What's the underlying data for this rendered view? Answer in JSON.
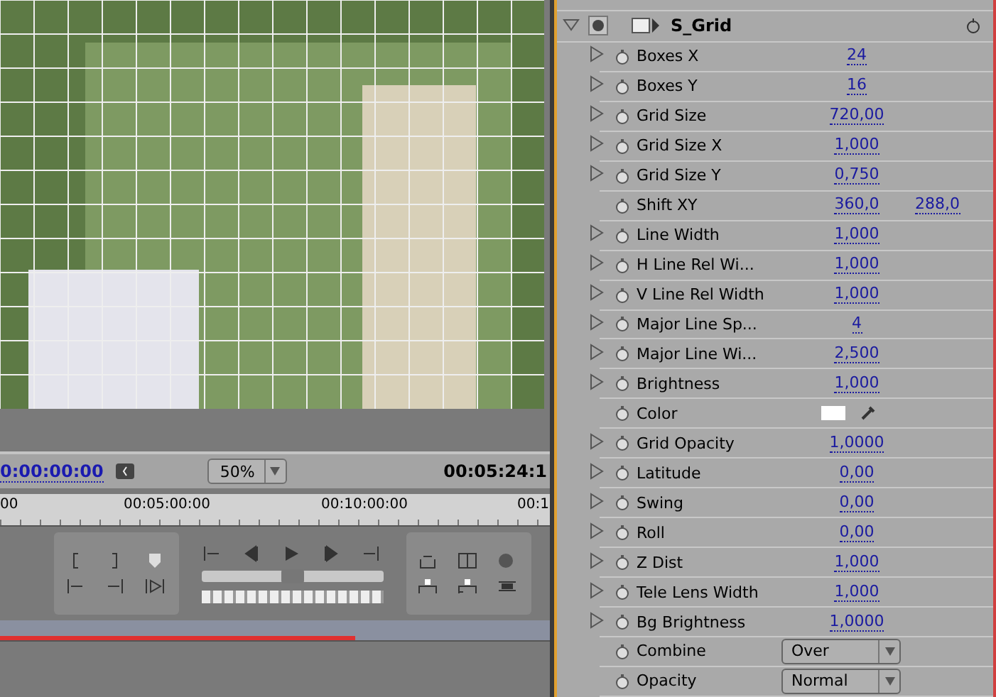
{
  "monitor": {
    "current_time": "0:00:00:00",
    "zoom": "50%",
    "duration": "00:05:24:1"
  },
  "ruler": {
    "labels": [
      "00",
      "00:05:00:00",
      "00:10:00:00",
      "00:1"
    ]
  },
  "timeline": {
    "level": 0.645
  },
  "shuttle": {
    "level": 0.5
  },
  "effect": {
    "name": "S_Grid",
    "expanded": true
  },
  "params": [
    {
      "kind": "value",
      "label": "Boxes X",
      "value": "24",
      "expandable": true
    },
    {
      "kind": "value",
      "label": "Boxes Y",
      "value": "16",
      "expandable": true
    },
    {
      "kind": "value",
      "label": "Grid Size",
      "value": "720,00",
      "expandable": true
    },
    {
      "kind": "value",
      "label": "Grid Size X",
      "value": "1,000",
      "expandable": true
    },
    {
      "kind": "value",
      "label": "Grid Size Y",
      "value": "0,750",
      "expandable": true
    },
    {
      "kind": "pair",
      "label": "Shift XY",
      "value": "360,0",
      "value2": "288,0",
      "expandable": false
    },
    {
      "kind": "value",
      "label": "Line Width",
      "value": "1,000",
      "expandable": true
    },
    {
      "kind": "value",
      "label": "H Line Rel Wi...",
      "value": "1,000",
      "expandable": true
    },
    {
      "kind": "value",
      "label": "V Line Rel Width",
      "value": "1,000",
      "expandable": true
    },
    {
      "kind": "value",
      "label": "Major Line Sp...",
      "value": "4",
      "expandable": true
    },
    {
      "kind": "value",
      "label": "Major Line Wi...",
      "value": "2,500",
      "expandable": true
    },
    {
      "kind": "value",
      "label": "Brightness",
      "value": "1,000",
      "expandable": true
    },
    {
      "kind": "color",
      "label": "Color",
      "color": "#ffffff",
      "expandable": false
    },
    {
      "kind": "value",
      "label": "Grid Opacity",
      "value": "1,0000",
      "expandable": true
    },
    {
      "kind": "value",
      "label": "Latitude",
      "value": "0,00",
      "expandable": true
    },
    {
      "kind": "value",
      "label": "Swing",
      "value": "0,00",
      "expandable": true
    },
    {
      "kind": "value",
      "label": "Roll",
      "value": "0,00",
      "expandable": true
    },
    {
      "kind": "value",
      "label": "Z Dist",
      "value": "1,000",
      "expandable": true
    },
    {
      "kind": "value",
      "label": "Tele Lens Width",
      "value": "1,000",
      "expandable": true
    },
    {
      "kind": "value",
      "label": "Bg Brightness",
      "value": "1,0000",
      "expandable": true
    },
    {
      "kind": "dropdown",
      "label": "Combine",
      "value": "Over",
      "expandable": false
    },
    {
      "kind": "dropdown",
      "label": "Opacity",
      "value": "Normal",
      "expandable": false
    }
  ]
}
